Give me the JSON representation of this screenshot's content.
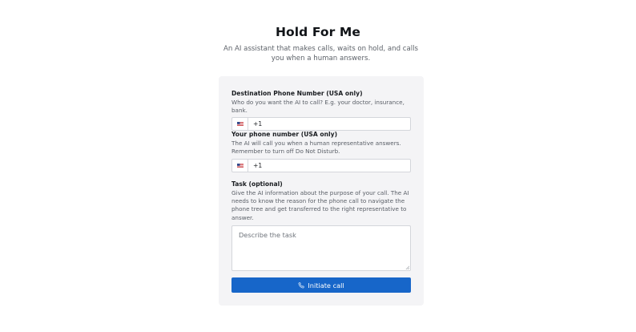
{
  "header": {
    "title": "Hold For Me",
    "subtitle": "An AI assistant that makes calls, waits on hold, and calls you when a human answers."
  },
  "form": {
    "destination": {
      "label": "Destination Phone Number (USA only)",
      "help": "Who do you want the AI to call? E.g. your doctor, insurance, bank.",
      "country_flag": "us-flag-icon",
      "value": "+1"
    },
    "your_phone": {
      "label": "Your phone number (USA only)",
      "help": "The AI will call you when a human representative answers. Remember to turn off Do Not Disturb.",
      "country_flag": "us-flag-icon",
      "value": "+1"
    },
    "task": {
      "label": "Task (optional)",
      "help": "Give the AI information about the purpose of your call. The AI needs to know the reason for the phone call to navigate the phone tree and get transferred to the right representative to answer.",
      "placeholder": "Describe the task",
      "value": ""
    },
    "submit": {
      "label": "Initiate call",
      "icon": "phone-icon"
    }
  },
  "colors": {
    "accent": "#1766c9",
    "card_background": "#f4f4f6",
    "input_border": "#d4d6db"
  }
}
